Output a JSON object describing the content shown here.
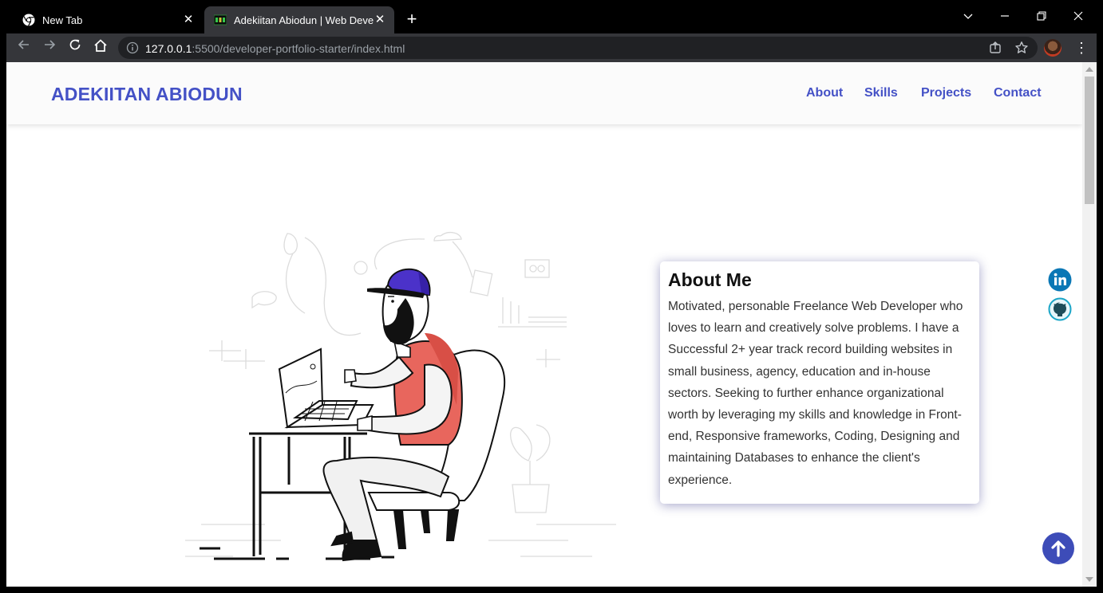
{
  "browser": {
    "tabs": [
      {
        "title": "New Tab",
        "active": false,
        "icon": "chrome-icon"
      },
      {
        "title": "Adekiitan Abiodun | Web Develop",
        "active": true,
        "icon": "site-favicon"
      }
    ],
    "url_host": "127.0.0.1",
    "url_path": ":5500/developer-portfolio-starter/index.html"
  },
  "header": {
    "logo": "ADEKIITAN ABIODUN",
    "nav": [
      "About",
      "Skills",
      "Projects",
      "Contact"
    ]
  },
  "about": {
    "heading": "About Me",
    "body": "Motivated, personable Freelance Web Developer who loves to learn and creatively solve problems. I have a Successful 2+ year track record building websites in small business, agency, education and in-house sectors. Seeking to further enhance organizational worth by leveraging my skills and knowledge in Front-end, Responsive frameworks, Coding, Designing and maintaining Databases to enhance the client's experience."
  },
  "social": [
    "linkedin-icon",
    "github-icon"
  ],
  "colors": {
    "brand": "#4451c6",
    "to_top_button": "#3d4cb8",
    "linkedin": "#0a77b5",
    "shirt": "#e8665d",
    "cap": "#4b32c9"
  }
}
